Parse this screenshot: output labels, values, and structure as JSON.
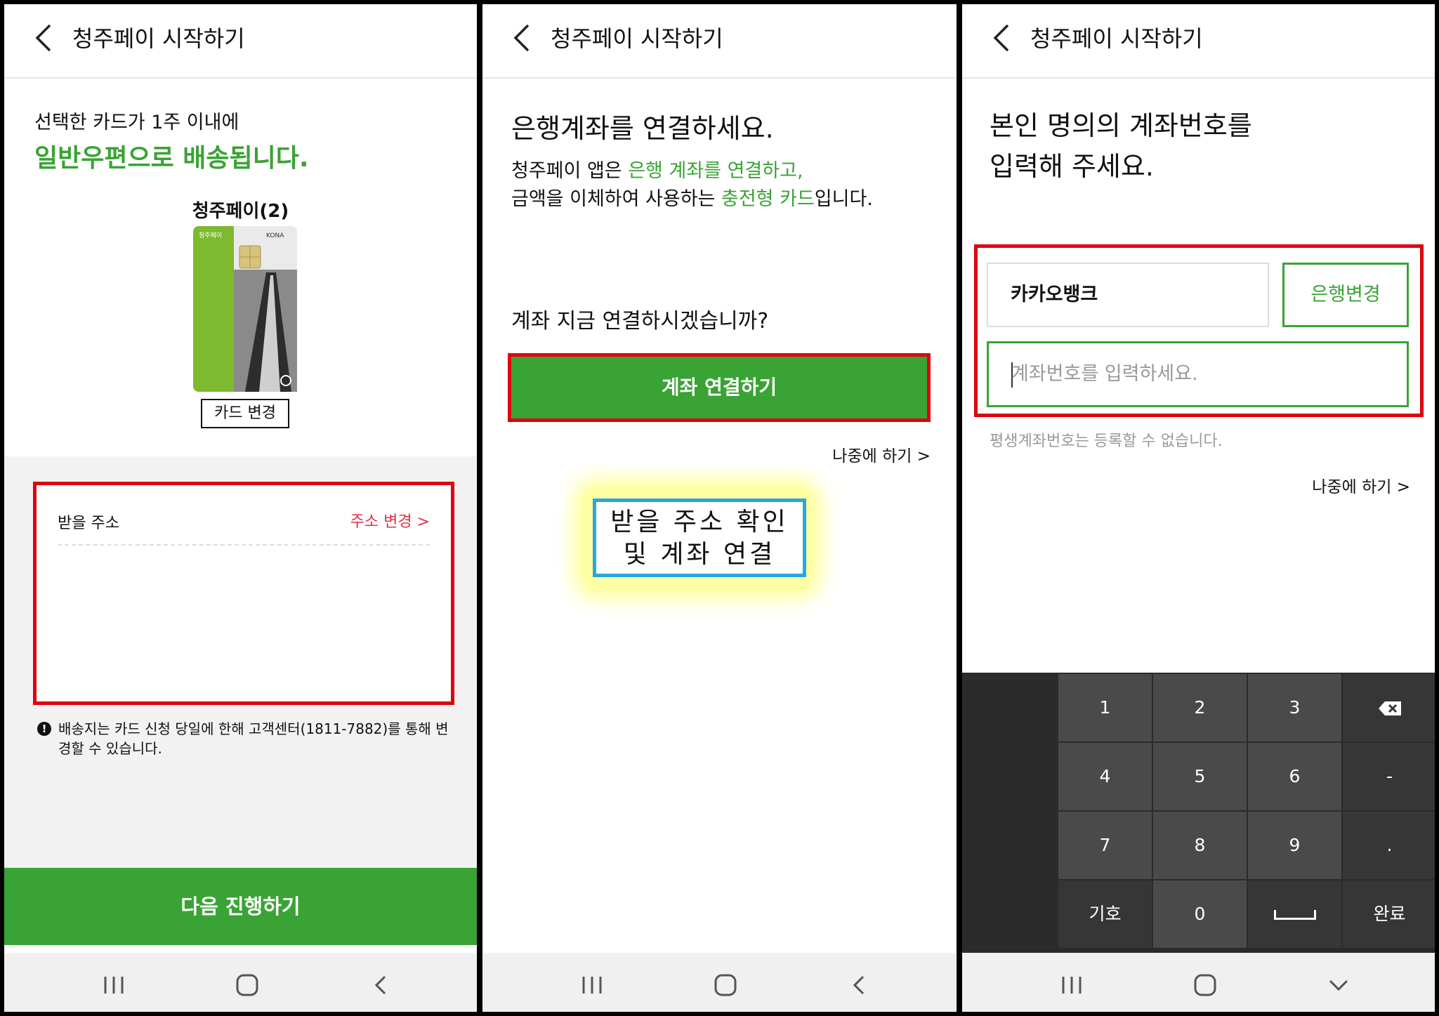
{
  "screens": [
    {
      "title": "청주페이 시작하기",
      "line1": "선택한 카드가 1주 이내에",
      "line2": "일반우편으로 배송됩니다.",
      "card": {
        "name": "청주페이(2)",
        "logo_text": "청주페이",
        "brand_text": "KONA",
        "change_label": "카드 변경"
      },
      "address": {
        "label": "받을 주소",
        "change_label": "주소 변경 >"
      },
      "notice": {
        "icon_text": "!",
        "text": "배송지는 카드 신청 당일에 한해 고객센터(1811-7882)를 통해 변경할 수 있습니다."
      },
      "next_button": "다음 진행하기"
    },
    {
      "title": "청주페이 시작하기",
      "heading": "은행계좌를 연결하세요.",
      "desc": {
        "p1": "청주페이 앱은 ",
        "p2": "은행 계좌를 연결하고,",
        "p3": "금액을 이체하여 사용하는 ",
        "p4": "충전형 카드",
        "p5": "입니다."
      },
      "question": "계좌 지금 연결하시겠습니까?",
      "connect_button": "계좌 연결하기",
      "later": "나중에 하기 >"
    },
    {
      "title": "청주페이 시작하기",
      "heading_line1": "본인 명의의 계좌번호를",
      "heading_line2": "입력해 주세요.",
      "bank_name": "카카오뱅크",
      "bank_change": "은행변경",
      "account_placeholder": "계좌번호를 입력하세요.",
      "note": "평생계좌번호는 등록할 수 없습니다.",
      "later": "나중에 하기 >",
      "keypad": {
        "keys": [
          "1",
          "2",
          "3",
          "4",
          "5",
          "6",
          "-",
          "7",
          "8",
          "9",
          ".",
          "기호",
          "0",
          "완료"
        ],
        "backspace_icon": "backspace-icon",
        "space_icon": "space-icon"
      }
    }
  ],
  "annotation": {
    "line1": "받을 주소 확인",
    "line2": "및 계좌 연결"
  },
  "colors": {
    "primary_green": "#3aa335",
    "highlight_red": "#e00010",
    "callout_blue": "#29a6e2",
    "callout_glow": "#ffff9c",
    "link_red": "#e0314a"
  },
  "nav_icons": [
    "recent-apps-icon",
    "home-icon",
    "back-icon",
    "keyboard-hide-icon"
  ]
}
